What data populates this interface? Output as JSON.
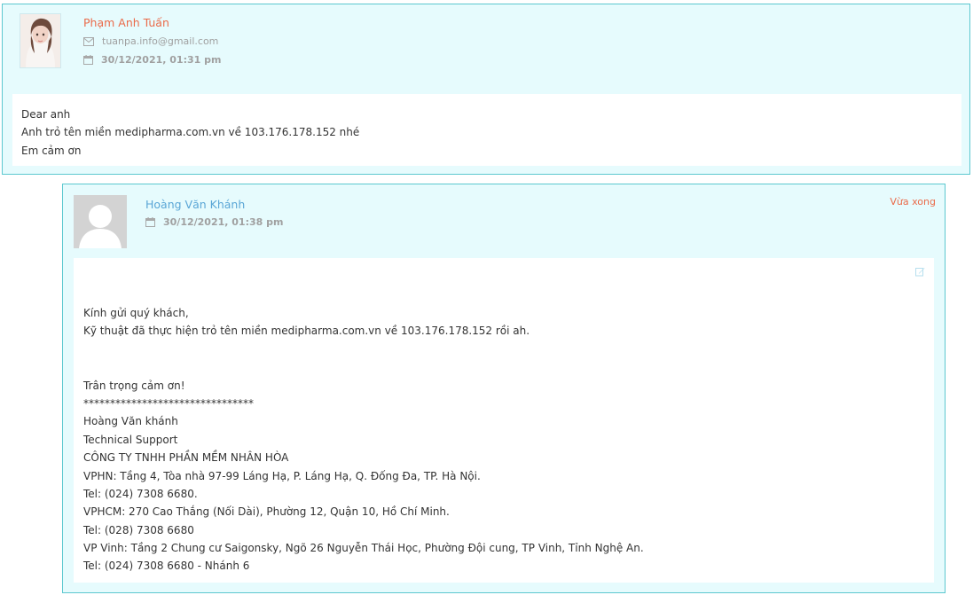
{
  "messages": [
    {
      "author": "Phạm Anh Tuấn",
      "email": "tuanpa.info@gmail.com",
      "date": "30/12/2021, 01:31 pm",
      "lines": [
        "Dear anh",
        "Anh trỏ tên miền medipharma.com.vn về 103.176.178.152 nhé",
        "Em cảm ơn"
      ]
    },
    {
      "author": "Hoàng Văn Khánh",
      "date": "30/12/2021, 01:38 pm",
      "status": "Vừa xong",
      "lines": [
        "Kính gửi quý khách,",
        "Kỹ thuật đã thực hiện trỏ tên miền medipharma.com.vn về 103.176.178.152 rồi ah.",
        "",
        "",
        "Trân trọng cảm ơn!",
        "********************************",
        "Hoàng Văn khánh",
        "Technical Support",
        "CÔNG TY TNHH PHẦN MỀM NHÂN HÒA",
        "VPHN: Tầng 4, Tòa nhà 97-99 Láng Hạ, P. Láng Hạ, Q. Đống Đa, TP. Hà Nội.",
        "Tel: (024) 7308 6680.",
        "VPHCM: 270 Cao Thắng (Nối Dài), Phường 12, Quận 10, Hồ Chí Minh.",
        "Tel: (028) 7308 6680",
        "VP Vinh: Tầng 2 Chung cư Saigonsky, Ngõ 26 Nguyễn Thái Học, Phường Đội cung, TP Vinh, Tỉnh Nghệ An.",
        "Tel: (024) 7308 6680 - Nhánh 6"
      ]
    }
  ],
  "icons": {
    "email": "envelope-icon",
    "date": "calendar-icon",
    "edit": "edit-icon"
  },
  "colors": {
    "card_bg": "#e6fbfd",
    "card_border": "#5cc8cf",
    "customer_name": "#ea6b4a",
    "staff_name": "#5aa6d6",
    "status": "#ea6b4a"
  }
}
